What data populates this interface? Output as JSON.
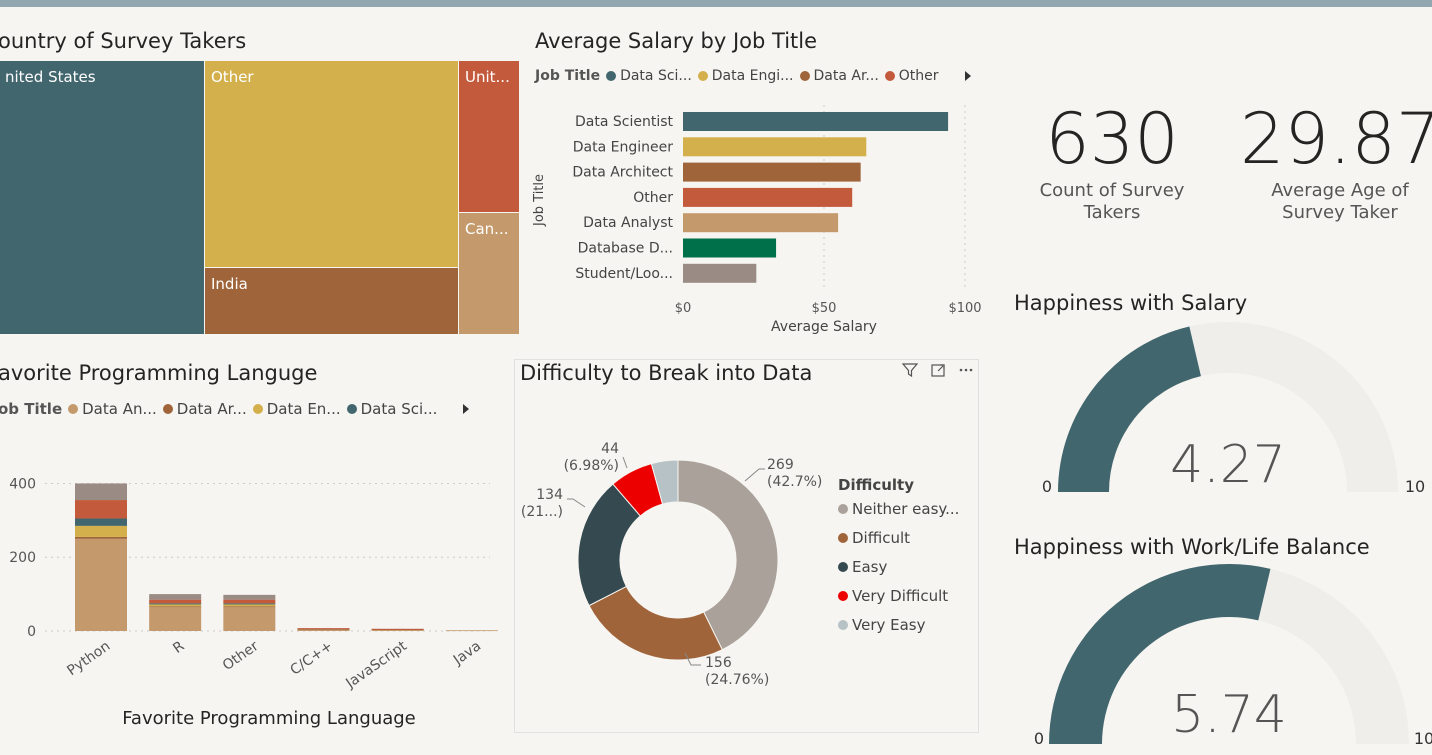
{
  "treemap": {
    "title": "ountry of Survey Takers",
    "cells": [
      {
        "label": "nited States",
        "color": "#42666e"
      },
      {
        "label": "Other",
        "color": "#d4b04c"
      },
      {
        "label": "India",
        "color": "#a0643a"
      },
      {
        "label": "Unit...",
        "color": "#c45a3c"
      },
      {
        "label": "Can...",
        "color": "#c49a6c"
      }
    ]
  },
  "salary": {
    "title": "Average Salary by Job Title",
    "legend_title": "Job Title",
    "legend": [
      {
        "label": "Data Sci...",
        "color": "#42666e"
      },
      {
        "label": "Data Engi...",
        "color": "#d4b04c"
      },
      {
        "label": "Data Ar...",
        "color": "#a0643a"
      },
      {
        "label": "Other",
        "color": "#c45a3c"
      }
    ],
    "ylabel": "Job Title",
    "xlabel": "Average Salary"
  },
  "kpis": [
    {
      "value": "630",
      "label_line1": "Count of Survey",
      "label_line2": "Takers"
    },
    {
      "value": "29.87",
      "label_line1": "Average Age of",
      "label_line2": "Survey Taker"
    }
  ],
  "gauge_salary": {
    "title": "Happiness with Salary",
    "value": "4.27",
    "min": "0",
    "max": "10",
    "fraction": 0.427
  },
  "gauge_wlb": {
    "title": "Happiness with Work/Life Balance",
    "value": "5.74",
    "min": "0",
    "max": "10",
    "fraction": 0.574
  },
  "lang": {
    "title": "avorite Programming Languge",
    "legend_title": "ob Title",
    "legend": [
      {
        "label": "Data An...",
        "color": "#c49a6c"
      },
      {
        "label": "Data Ar...",
        "color": "#a0643a"
      },
      {
        "label": "Data En...",
        "color": "#d4b04c"
      },
      {
        "label": "Data Sci...",
        "color": "#42666e"
      }
    ],
    "xlabel": "Favorite Programming Language"
  },
  "difficulty": {
    "title": "Difficulty to Break into Data",
    "legend_title": "Difficulty",
    "legend": [
      {
        "label": "Neither easy...",
        "color": "#aaa29a"
      },
      {
        "label": "Difficult",
        "color": "#a0643a"
      },
      {
        "label": "Easy",
        "color": "#344a50"
      },
      {
        "label": "Very Difficult",
        "color": "#ec0000"
      },
      {
        "label": "Very Easy",
        "color": "#b6c2c6"
      }
    ]
  },
  "chart_data": [
    {
      "type": "bar",
      "orientation": "horizontal",
      "title": "Average Salary by Job Title",
      "xlabel": "Average Salary",
      "ylabel": "Job Title",
      "categories": [
        "Data Scientist",
        "Data Engineer",
        "Data Architect",
        "Other",
        "Data Analyst",
        "Database D...",
        "Student/Loo..."
      ],
      "values": [
        94,
        65,
        63,
        60,
        55,
        33,
        26
      ],
      "colors": [
        "#42666e",
        "#d4b04c",
        "#a0643a",
        "#c45a3c",
        "#c49a6c",
        "#00704a",
        "#9a8c84"
      ],
      "xlim": [
        0,
        100
      ],
      "xticks": [
        "$0",
        "$50",
        "$100"
      ],
      "xtick_values": [
        0,
        50,
        100
      ],
      "grid": true
    },
    {
      "type": "bar",
      "stacked": true,
      "title": "Favorite Programming Languge",
      "xlabel": "Favorite Programming Language",
      "categories": [
        "Python",
        "R",
        "Other",
        "C/C++",
        "JavaScript",
        "Java"
      ],
      "series": [
        {
          "name": "Data An...",
          "color": "#c49a6c",
          "values": [
            250,
            65,
            65,
            5,
            4,
            2
          ]
        },
        {
          "name": "Data Ar...",
          "color": "#a0643a",
          "values": [
            5,
            2,
            2,
            1,
            1,
            0
          ]
        },
        {
          "name": "Data En...",
          "color": "#d4b04c",
          "values": [
            30,
            5,
            5,
            0,
            0,
            0
          ]
        },
        {
          "name": "Data Sci...",
          "color": "#42666e",
          "values": [
            20,
            3,
            3,
            0,
            0,
            0
          ]
        },
        {
          "name": "",
          "color": "#c45a3c",
          "values": [
            50,
            10,
            10,
            2,
            1,
            0
          ]
        },
        {
          "name": "",
          "color": "#9a8c84",
          "values": [
            45,
            15,
            13,
            0,
            0,
            0
          ]
        }
      ],
      "ylim": [
        0,
        450
      ],
      "yticks": [
        0,
        200,
        400
      ],
      "grid": true
    },
    {
      "type": "pie",
      "donut": true,
      "title": "Difficulty to Break into Data",
      "categories": [
        "Neither easy...",
        "Difficult",
        "Easy",
        "Very Difficult",
        "Very Easy"
      ],
      "values": [
        269,
        156,
        134,
        44,
        27
      ],
      "colors": [
        "#aaa29a",
        "#a0643a",
        "#344a50",
        "#ec0000",
        "#b6c2c6"
      ],
      "data_labels": [
        [
          "269",
          "(42.7%)"
        ],
        [
          "156",
          "(24.76%)"
        ],
        [
          "134",
          "(21...)"
        ],
        [
          "44",
          "(6.98%)"
        ],
        [
          "",
          ""
        ]
      ]
    }
  ]
}
